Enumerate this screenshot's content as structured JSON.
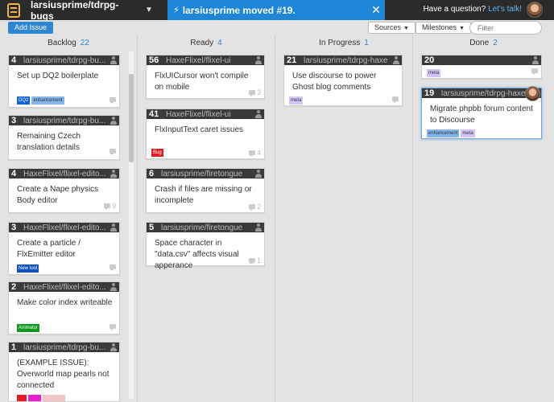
{
  "header": {
    "repo": "larsiusprime/tdrpg-bugs",
    "notification": "larsiusprime moved #19.",
    "question_text": "Have a question?",
    "question_link": "Let's talk!"
  },
  "toolbar": {
    "add_issue": "Add Issue",
    "sources": "Sources",
    "milestones": "Milestones",
    "filter_placeholder": "Filter"
  },
  "columns": [
    {
      "name": "Backlog",
      "count": "22",
      "cards": [
        {
          "num": "4",
          "repo": "larsiusprime/tdrpg-bu...",
          "title": "Set up DQ2 boilerplate",
          "comments": "",
          "labels": [
            {
              "text": "DQ2",
              "color": "#1060d8"
            },
            {
              "text": "enhancement",
              "color": "#84b6eb"
            }
          ]
        },
        {
          "num": "3",
          "repo": "larsiusprime/tdrpg-bu...",
          "title": "Remaining Czech translation details",
          "comments": "",
          "labels": []
        },
        {
          "num": "4",
          "repo": "HaxeFlixel/flixel-edito...",
          "title": "Create a Nape physics Body editor",
          "comments": "9",
          "labels": []
        },
        {
          "num": "3",
          "repo": "HaxeFlixel/flixel-edito...",
          "title": "Create a particle / FlxEmitter editor",
          "comments": "",
          "labels": [
            {
              "text": "New tool",
              "color": "#0d52bf"
            }
          ]
        },
        {
          "num": "2",
          "repo": "HaxeFlixel/flixel-edito...",
          "title": "Make color index writeable",
          "comments": "",
          "labels": [
            {
              "text": "Animator",
              "color": "#0b9a1c"
            }
          ]
        },
        {
          "num": "1",
          "repo": "larsiusprime/tdrpg-bu...",
          "title": "(EXAMPLE ISSUE): Overworld map pearls not connected",
          "comments": "",
          "labels": [
            {
              "text": "",
              "color": "#e11d21"
            },
            {
              "text": "",
              "color": "#eb1fd0"
            },
            {
              "text": "",
              "color": "#f2c6c6"
            }
          ]
        }
      ]
    },
    {
      "name": "Ready",
      "count": "4",
      "cards": [
        {
          "num": "56",
          "repo": "HaxeFlixel/flixel-ui",
          "title": "FlxUICursor won't compile on mobile",
          "comments": "3",
          "labels": []
        },
        {
          "num": "41",
          "repo": "HaxeFlixel/flixel-ui",
          "title": "FlxInputText caret issues",
          "comments": "4",
          "labels": [
            {
              "text": "Bug",
              "color": "#e11d21"
            }
          ]
        },
        {
          "num": "6",
          "repo": "larsiusprime/firetongue",
          "title": "Crash if files are missing or incomplete",
          "comments": "2",
          "labels": []
        },
        {
          "num": "5",
          "repo": "larsiusprime/firetongue",
          "title": "Space character in \"data.csv\" affects visual apperance",
          "comments": "1",
          "labels": []
        }
      ]
    },
    {
      "name": "In Progress",
      "count": "1",
      "cards": [
        {
          "num": "21",
          "repo": "larsiusprime/tdrpg-haxe",
          "title": "Use discourse to power Ghost blog comments",
          "comments": "",
          "labels": [
            {
              "text": "meta",
              "color": "#d4c5f9"
            }
          ]
        }
      ]
    },
    {
      "name": "Done",
      "count": "2",
      "cards": [
        {
          "num": "20",
          "repo": "",
          "title": "",
          "comments": "",
          "labels": [
            {
              "text": "meta",
              "color": "#d4c5f9"
            }
          ]
        },
        {
          "num": "19",
          "repo": "larsiusprime/tdrpg-haxe",
          "title": "Migrate phpbb forum content to Discourse",
          "comments": "",
          "labels": [
            {
              "text": "enhancement",
              "color": "#84b6eb"
            },
            {
              "text": "meta",
              "color": "#d4c5f9"
            }
          ]
        }
      ]
    }
  ],
  "icons": [
    "board-logo-icon",
    "lightning-icon",
    "close-icon",
    "person-icon",
    "comment-icon",
    "caret-down-icon"
  ]
}
